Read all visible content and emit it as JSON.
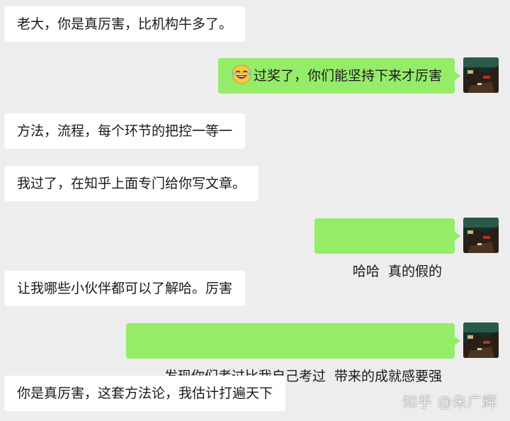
{
  "messages": [
    {
      "side": "left",
      "text": "老大，你是真厉害，比机构牛多了。"
    },
    {
      "side": "right",
      "emoji": "laughing-tears-emoji",
      "text": "过奖了，你们能坚持下来才厉害"
    },
    {
      "side": "left",
      "text": "方法，流程，每个环节的把控一等一"
    },
    {
      "side": "left",
      "text": "我过了，在知乎上面专门给你写文章。"
    },
    {
      "side": "right",
      "text": "哈哈  真的假的"
    },
    {
      "side": "left",
      "text": "让我哪些小伙伴都可以了解哈。厉害"
    },
    {
      "side": "right",
      "text": "发现你们考过比我自己考过  带来的成就感要强"
    },
    {
      "side": "left",
      "text": "你是真厉害，这套方法论，我估计打遍天下"
    }
  ],
  "watermark": "知乎 @朱广辉",
  "colors": {
    "background": "#ededed",
    "incoming_bubble": "#ffffff",
    "outgoing_bubble": "#95ec69"
  }
}
